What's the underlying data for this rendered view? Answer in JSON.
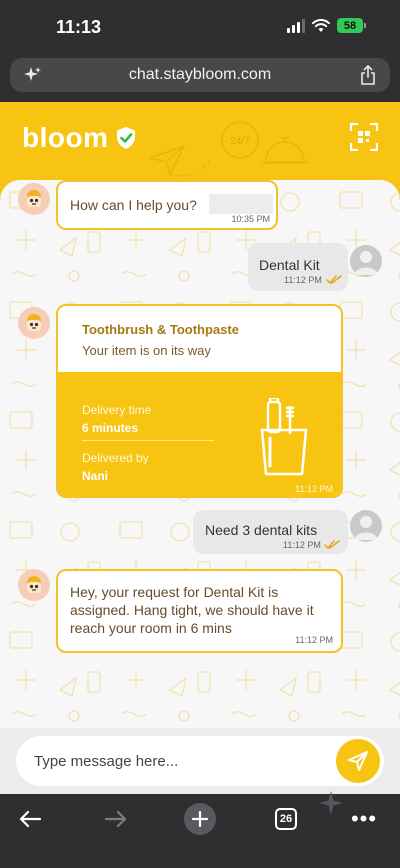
{
  "status_bar": {
    "time": "11:13",
    "battery": "58"
  },
  "browser": {
    "url": "chat.staybloom.com",
    "tabs_count": "26"
  },
  "header": {
    "brand": "bloom",
    "deco_text": "24/7"
  },
  "messages": [
    {
      "type": "bot",
      "text": "How can I help you?",
      "time": "10:35 PM"
    },
    {
      "type": "user",
      "text": "Dental Kit",
      "time": "11:12 PM"
    },
    {
      "type": "user",
      "text": "Need 3 dental kits",
      "time": "11:12 PM"
    },
    {
      "type": "bot",
      "text": "Hey, your request for Dental Kit is assigned. Hang tight, we should have it reach your room in 6 mins",
      "time": "11:12 PM"
    }
  ],
  "order_card": {
    "title": "Toothbrush & Toothpaste",
    "status": "Your item is on its way",
    "delivery_time_label": "Delivery time",
    "delivery_time_value": "6 minutes",
    "delivered_by_label": "Delivered by",
    "delivered_by_value": "Nani",
    "time": "11:12 PM"
  },
  "composer": {
    "placeholder": "Type message here..."
  },
  "colors": {
    "brand_yellow": "#f7c411",
    "bubble_border": "#f2c22a",
    "read_tick": "#e0a81a"
  },
  "icons": [
    "sparkle-icon",
    "share-icon",
    "verified-badge-icon",
    "qr-scan-icon",
    "bot-avatar-icon",
    "user-avatar-icon",
    "double-check-icon",
    "toothbrush-cup-icon",
    "send-icon",
    "back-arrow-icon",
    "forward-arrow-icon",
    "plus-icon",
    "tabs-icon",
    "more-icon"
  ]
}
